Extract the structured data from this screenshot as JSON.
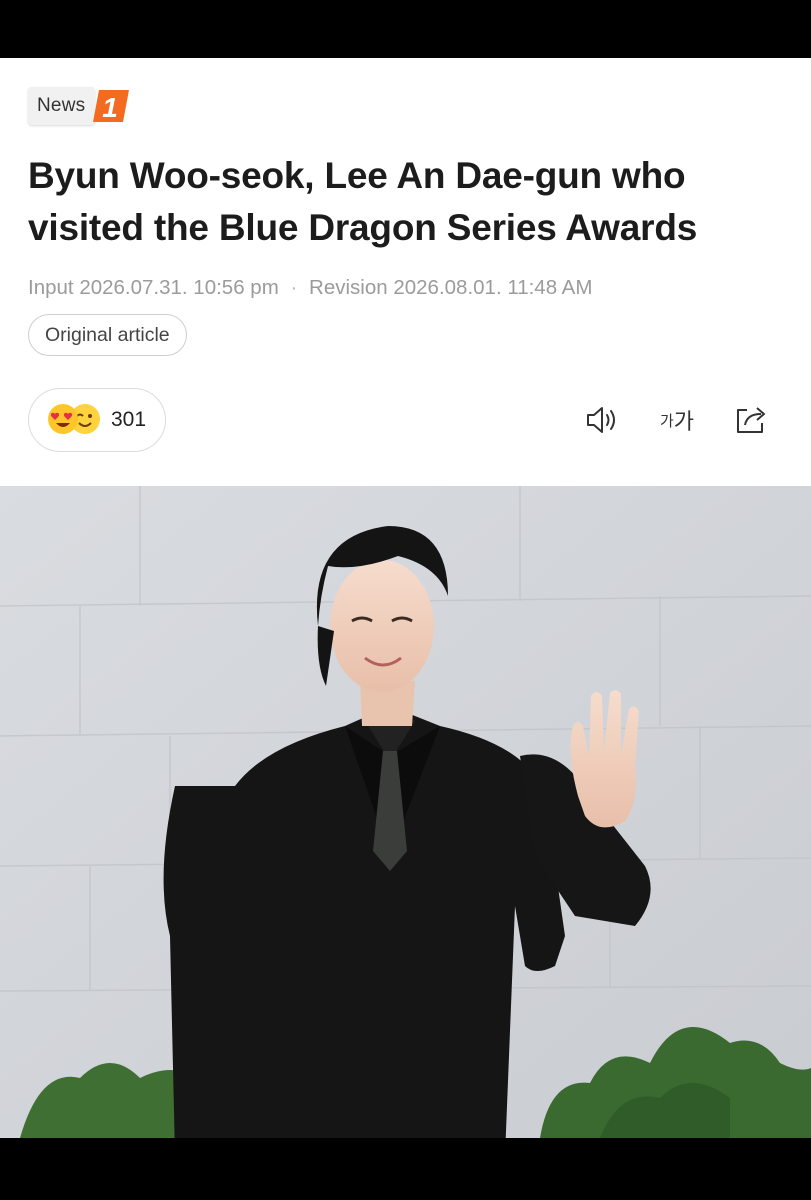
{
  "brand": {
    "news_label": "News",
    "number_label": "1",
    "accent": "#f26b21"
  },
  "article": {
    "title": "Byun Woo-seok, Lee An Dae-gun who visited the Blue Dragon Series Awards",
    "input_label": "Input",
    "input_time": "2026.07.31. 10:56 pm",
    "separator": "·",
    "revision_label": "Revision",
    "revision_time": "2026.08.01. 11:48 AM",
    "original_button": "Original article"
  },
  "reactions": {
    "count": "301",
    "icons": [
      "heart-eyes-emoji-icon",
      "wink-emoji-icon"
    ]
  },
  "toolbar": {
    "audio_icon": "speaker-icon",
    "font_small": "가",
    "font_large": "가",
    "share_icon": "share-icon"
  },
  "photo": {
    "description_icon": "article-photo"
  }
}
